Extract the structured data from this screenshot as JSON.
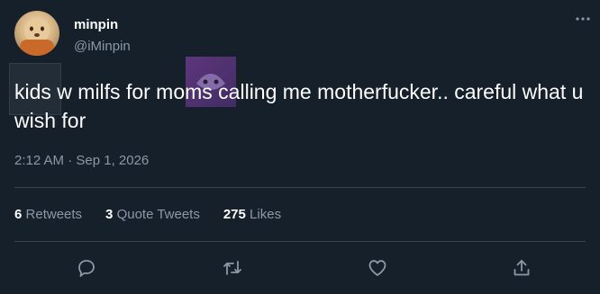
{
  "author": {
    "display_name": "minpin",
    "handle": "@iMinpin"
  },
  "tweet": {
    "text": "kids w milfs for moms calling me motherfucker.. careful what u wish for",
    "timestamp": "2:12 AM · Sep 1, 2026"
  },
  "stats": {
    "retweets_count": "6",
    "retweets_label": "Retweets",
    "quote_tweets_count": "3",
    "quote_tweets_label": "Quote Tweets",
    "likes_count": "275",
    "likes_label": "Likes"
  },
  "actions": [
    "reply-icon",
    "retweet-icon",
    "like-icon",
    "share-icon"
  ],
  "colors": {
    "background": "#15202b",
    "text_primary": "#ffffff",
    "text_secondary": "#8b98a5",
    "divider": "#38444d"
  }
}
